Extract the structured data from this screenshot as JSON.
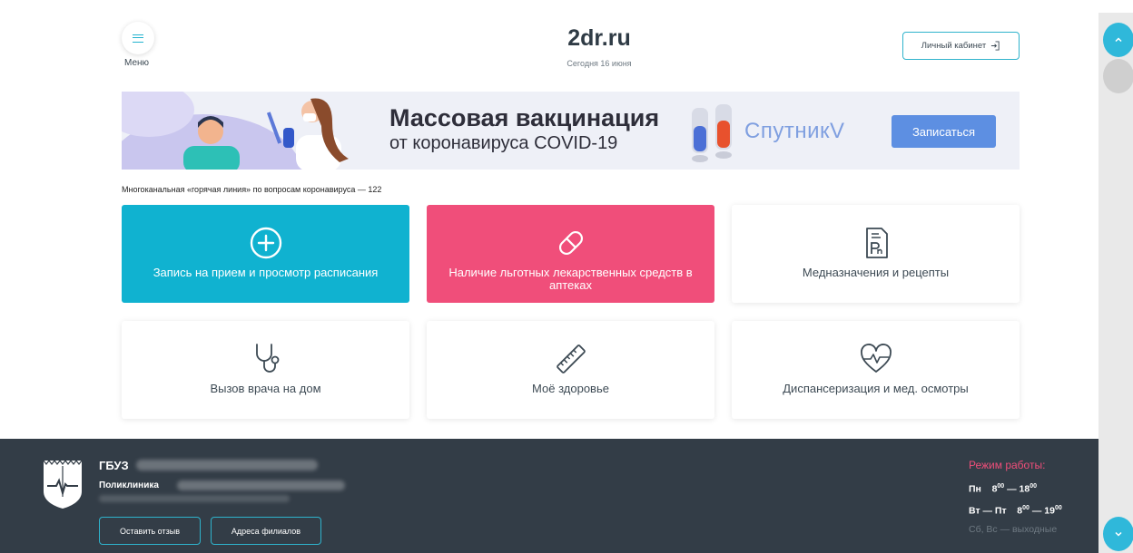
{
  "header": {
    "menu_label": "Меню",
    "site_title": "2dr.ru",
    "date_text": "Сегодня 16 июня",
    "cabinet_label": "Личный кабинет"
  },
  "banner": {
    "title": "Массовая вакцинация",
    "subtitle": "от коронавируса COVID-19",
    "brand": "СпутникV",
    "button_label": "Записаться"
  },
  "hotline_text": "Многоканальная «горячая линия» по вопросам коронавируса — 122",
  "tiles": [
    {
      "label": "Запись на прием и просмотр расписания",
      "icon": "plus-circle-icon",
      "color": "#10b2d0"
    },
    {
      "label": "Наличие льготных лекарственных средств в аптеках",
      "icon": "pill-icon",
      "color": "#f04e7a"
    },
    {
      "label": "Медназначения и рецепты",
      "icon": "prescription-icon"
    },
    {
      "label": "Вызов врача на дом",
      "icon": "stethoscope-icon"
    },
    {
      "label": "Моё здоровье",
      "icon": "ruler-icon"
    },
    {
      "label": "Диспансеризация и мед. осмотры",
      "icon": "heart-pulse-icon"
    }
  ],
  "footer": {
    "org_name": "ГБУЗ",
    "org_sub": "Поликлиника",
    "feedback_button": "Оставить отзыв",
    "branches_button": "Адреса филиалов",
    "hours_title": "Режим работы:",
    "hours": [
      {
        "days": "Пн",
        "open": "8",
        "open_min": "00",
        "close": "18",
        "close_min": "00"
      },
      {
        "days": "Вт — Пт",
        "open": "8",
        "open_min": "00",
        "close": "19",
        "close_min": "00"
      }
    ],
    "weekend": "Сб, Вс — выходные"
  },
  "colors": {
    "accent": "#10b2d0",
    "pink": "#f04e7a",
    "footer_bg": "#333d47",
    "banner_button": "#5d8fe2"
  }
}
